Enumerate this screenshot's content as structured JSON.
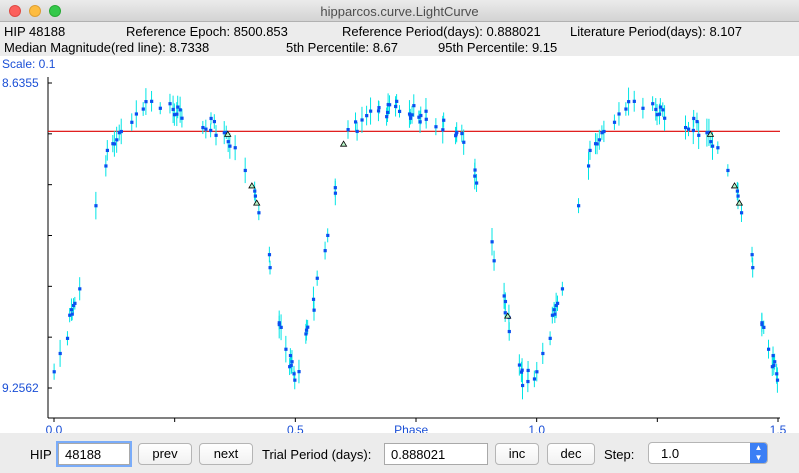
{
  "window": {
    "title": "hipparcos.curve.LightCurve"
  },
  "info": {
    "hip": "HIP 48188",
    "ref_epoch": "Reference Epoch: 8500.853",
    "ref_period": "Reference Period(days): 0.888021",
    "lit_period": "Literature Period(days): 8.107",
    "median": "Median Magnitude(red line): 8.7338",
    "p5": "5th Percentile: 8.67",
    "p95": "95th Percentile: 9.15"
  },
  "chart_data": {
    "type": "scatter",
    "xlabel": "Phase",
    "scale_label": "Scale: 0.1",
    "x_ticks": [
      "0.0",
      "0.5",
      "1.0",
      "1.5"
    ],
    "y_ticks": [
      "8.6355",
      "9.2562"
    ],
    "xlim": [
      0.0,
      1.5
    ],
    "ylim": [
      8.6355,
      9.2562
    ],
    "median_line": 8.7338,
    "colors": {
      "points": "#0a50f0",
      "errorbars": "#00e5e5",
      "median": "#dd0000",
      "axis_text": "#1a4fd6",
      "outlier_markers": "#000000"
    },
    "curve_anchors": [
      [
        0.0,
        9.22
      ],
      [
        0.03,
        9.13
      ],
      [
        0.06,
        9.02
      ],
      [
        0.09,
        8.88
      ],
      [
        0.11,
        8.77
      ],
      [
        0.14,
        8.72
      ],
      [
        0.17,
        8.7
      ],
      [
        0.2,
        8.68
      ],
      [
        0.24,
        8.69
      ],
      [
        0.27,
        8.7
      ],
      [
        0.3,
        8.71
      ],
      [
        0.33,
        8.72
      ],
      [
        0.36,
        8.74
      ],
      [
        0.38,
        8.77
      ],
      [
        0.4,
        8.81
      ],
      [
        0.42,
        8.88
      ],
      [
        0.44,
        8.97
      ],
      [
        0.46,
        9.08
      ],
      [
        0.48,
        9.19
      ],
      [
        0.5,
        9.23
      ],
      [
        0.52,
        9.17
      ],
      [
        0.55,
        9.03
      ],
      [
        0.58,
        8.86
      ],
      [
        0.6,
        8.76
      ],
      [
        0.63,
        8.72
      ],
      [
        0.66,
        8.7
      ],
      [
        0.7,
        8.68
      ],
      [
        0.74,
        8.69
      ],
      [
        0.78,
        8.7
      ],
      [
        0.82,
        8.73
      ],
      [
        0.85,
        8.76
      ],
      [
        0.87,
        8.82
      ],
      [
        0.89,
        8.9
      ],
      [
        0.91,
        8.98
      ],
      [
        0.93,
        9.06
      ],
      [
        0.95,
        9.16
      ],
      [
        0.97,
        9.24
      ],
      [
        1.0,
        9.22
      ]
    ]
  },
  "controls": {
    "hip_label": "HIP",
    "hip_value": "48188",
    "prev_label": "prev",
    "next_label": "next",
    "trial_label": "Trial Period (days):",
    "trial_value": "0.888021",
    "inc_label": "inc",
    "dec_label": "dec",
    "step_label": "Step:",
    "step_value": "1.0"
  }
}
